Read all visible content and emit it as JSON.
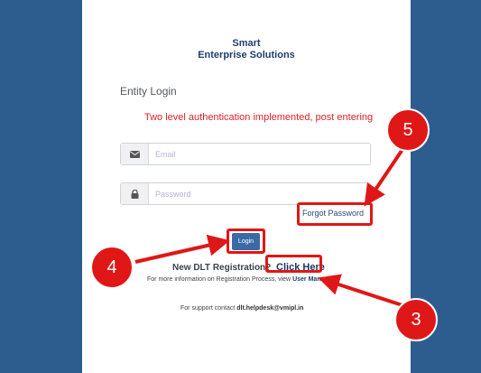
{
  "brand": {
    "line1": "Smart",
    "line2": "Enterprise Solutions"
  },
  "form": {
    "heading": "Entity Login",
    "auth_message": "Two level authentication implemented, post entering",
    "email_placeholder": "Email",
    "password_placeholder": "Password",
    "forgot_password": "Forgot Password",
    "login_button": "Login"
  },
  "registration": {
    "prompt": "New DLT Registration?",
    "click_here": "Click Here",
    "info_prefix": "For more information on Registration Process, view",
    "user_manual": "User Manual"
  },
  "support": {
    "prefix": "For support contact",
    "email": "dlt.helpdesk@vmipl.in"
  },
  "annotations": {
    "badge_3": "3",
    "badge_4": "4",
    "badge_5": "5"
  },
  "colors": {
    "background": "#2d5c8f",
    "accent": "#e01717",
    "button": "#3a6aa6",
    "error": "#d9232b"
  },
  "icons": {
    "email": "envelope-icon",
    "password": "lock-icon"
  }
}
